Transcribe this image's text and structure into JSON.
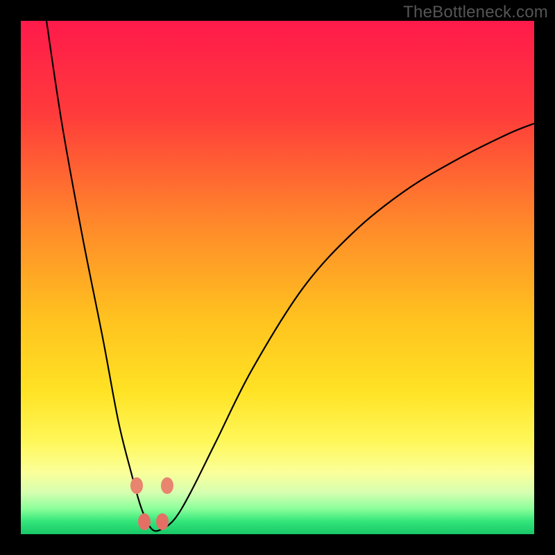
{
  "source_label": "TheBottleneck.com",
  "chart_data": {
    "type": "line",
    "title": "",
    "xlabel": "",
    "ylabel": "",
    "xlim": [
      0,
      100
    ],
    "ylim": [
      0,
      100
    ],
    "gradient_stops": [
      {
        "offset": 0,
        "color": "#ff1a4b"
      },
      {
        "offset": 0.18,
        "color": "#ff3b3b"
      },
      {
        "offset": 0.4,
        "color": "#ff8a2a"
      },
      {
        "offset": 0.58,
        "color": "#ffc21f"
      },
      {
        "offset": 0.72,
        "color": "#ffe224"
      },
      {
        "offset": 0.82,
        "color": "#fff85a"
      },
      {
        "offset": 0.88,
        "color": "#fbff9a"
      },
      {
        "offset": 0.92,
        "color": "#d4ffb0"
      },
      {
        "offset": 0.95,
        "color": "#8dff9b"
      },
      {
        "offset": 0.975,
        "color": "#33e67a"
      },
      {
        "offset": 1.0,
        "color": "#18c767"
      }
    ],
    "series": [
      {
        "name": "bottleneck-curve",
        "x": [
          5,
          8,
          12,
          16,
          19,
          21.5,
          23.5,
          25.5,
          27.5,
          30,
          33,
          38,
          45,
          55,
          65,
          75,
          85,
          95,
          100
        ],
        "y": [
          100,
          80,
          58,
          38,
          22,
          12,
          5,
          1,
          1,
          3,
          8,
          18,
          32,
          48,
          59,
          67,
          73,
          78,
          80
        ]
      }
    ],
    "markers": [
      {
        "x": 22.5,
        "y": 9.5,
        "color": "#e9846f"
      },
      {
        "x": 28.5,
        "y": 9.5,
        "color": "#e9846f"
      },
      {
        "x": 24.0,
        "y": 2.5,
        "color": "#e47065"
      },
      {
        "x": 27.5,
        "y": 2.5,
        "color": "#e47065"
      }
    ]
  }
}
